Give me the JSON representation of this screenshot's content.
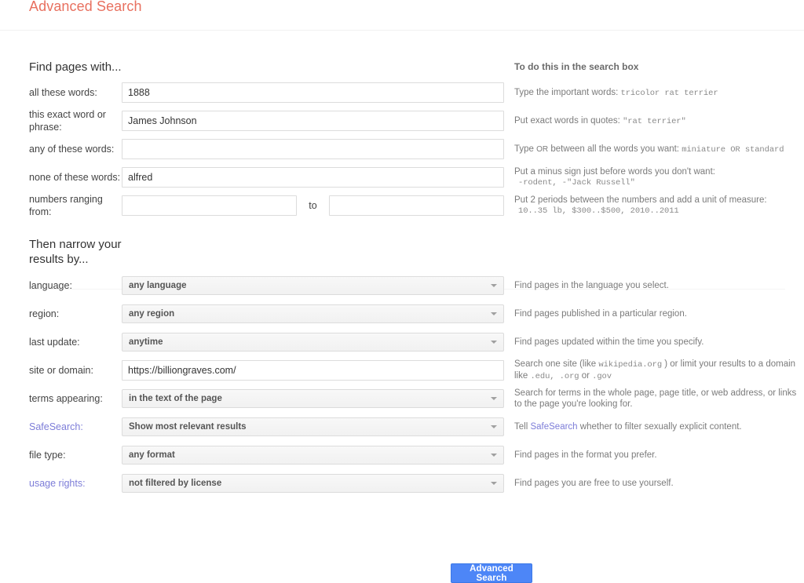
{
  "header": {
    "title": "Advanced Search"
  },
  "find_section": {
    "heading": "Find pages with...",
    "help_heading": "To do this in the search box",
    "rows": [
      {
        "label": "all these words:",
        "value": "1888",
        "help_text": "Type the important words:",
        "help_mono": "tricolor rat terrier"
      },
      {
        "label": "this exact word or phrase:",
        "value": "James Johnson",
        "help_text": "Put exact words in quotes:",
        "help_mono": "\"rat terrier\""
      },
      {
        "label": "any of these words:",
        "value": "",
        "help_text": "Type",
        "help_text_2": "between all the words you want:",
        "help_sc": "OR",
        "help_mono": "miniature OR standard"
      },
      {
        "label": "none of these words:",
        "value": "alfred",
        "help_text": "Put a minus sign just before words you don't want:",
        "help_mono": "-rodent, -\"Jack Russell\""
      },
      {
        "label": "numbers ranging from:",
        "value_from": "",
        "value_to": "",
        "to_word": "to",
        "help_text": "Put 2 periods between the numbers and add a unit of measure:",
        "help_mono": "10..35 lb, $300..$500, 2010..2011"
      }
    ]
  },
  "narrow_section": {
    "heading": "Then narrow your results by...",
    "rows": [
      {
        "label": "language:",
        "type": "select",
        "value": "any language",
        "help_text": "Find pages in the language you select."
      },
      {
        "label": "region:",
        "type": "select",
        "value": "any region",
        "help_text": "Find pages published in a particular region."
      },
      {
        "label": "last update:",
        "type": "select",
        "value": "anytime",
        "help_text": "Find pages updated within the time you specify."
      },
      {
        "label": "site or domain:",
        "type": "text",
        "value": "https://billiongraves.com/",
        "help_text": "Search one site (like",
        "help_mono": "wikipedia.org",
        "help_text_2": ") or limit your results to a domain like",
        "help_mono_2": ".edu, .org",
        "help_text_3": "or",
        "help_mono_3": ".gov"
      },
      {
        "label": "terms appearing:",
        "type": "select",
        "value": "in the text of the page",
        "help_text": "Search for terms in the whole page, page title, or web address, or links to the page you're looking for."
      },
      {
        "label": "SafeSearch:",
        "label_is_link": true,
        "type": "select",
        "value": "Show most relevant results",
        "help_text": "Tell",
        "help_link": "SafeSearch",
        "help_text_2": "whether to filter sexually explicit content."
      },
      {
        "label": "file type:",
        "type": "select",
        "value": "any format",
        "help_text": "Find pages in the format you prefer."
      },
      {
        "label": "usage rights:",
        "label_is_link": true,
        "type": "select",
        "value": "not filtered by license",
        "help_text": "Find pages you are free to use yourself."
      }
    ]
  },
  "submit": {
    "label": "Advanced Search"
  },
  "colors": {
    "title": "#e8705f",
    "button": "#4d86f7",
    "link": "#7d7dd8"
  }
}
